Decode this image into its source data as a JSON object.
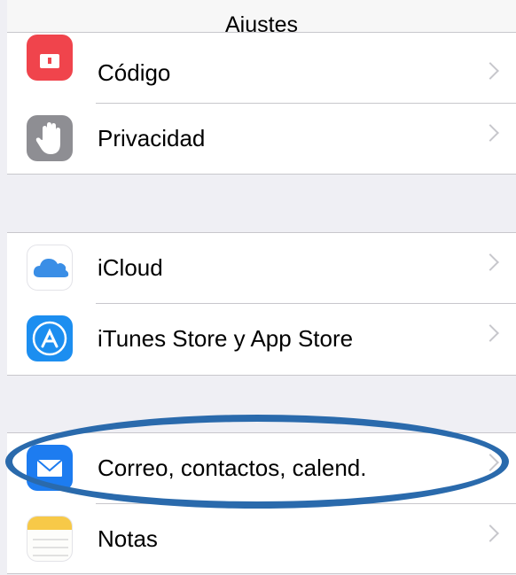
{
  "header": {
    "title": "Ajustes"
  },
  "groups": [
    {
      "items": [
        {
          "label": "Código",
          "icon": "passcode-icon",
          "color": "#f0444c"
        },
        {
          "label": "Privacidad",
          "icon": "privacy-hand-icon",
          "color": "#8e8e93"
        }
      ]
    },
    {
      "items": [
        {
          "label": "iCloud",
          "icon": "icloud-icon",
          "color": "#3a8ee6"
        },
        {
          "label": "iTunes Store y App Store",
          "icon": "app-store-icon",
          "color": "#1c8ef0"
        }
      ]
    },
    {
      "items": [
        {
          "label": "Correo, contactos, calend.",
          "icon": "mail-icon",
          "color": "#1d7cf0"
        },
        {
          "label": "Notas",
          "icon": "notes-icon",
          "color": "#f7c948"
        }
      ]
    }
  ],
  "annotation": {
    "color": "#2a6aac",
    "target": "Correo, contactos, calend."
  }
}
